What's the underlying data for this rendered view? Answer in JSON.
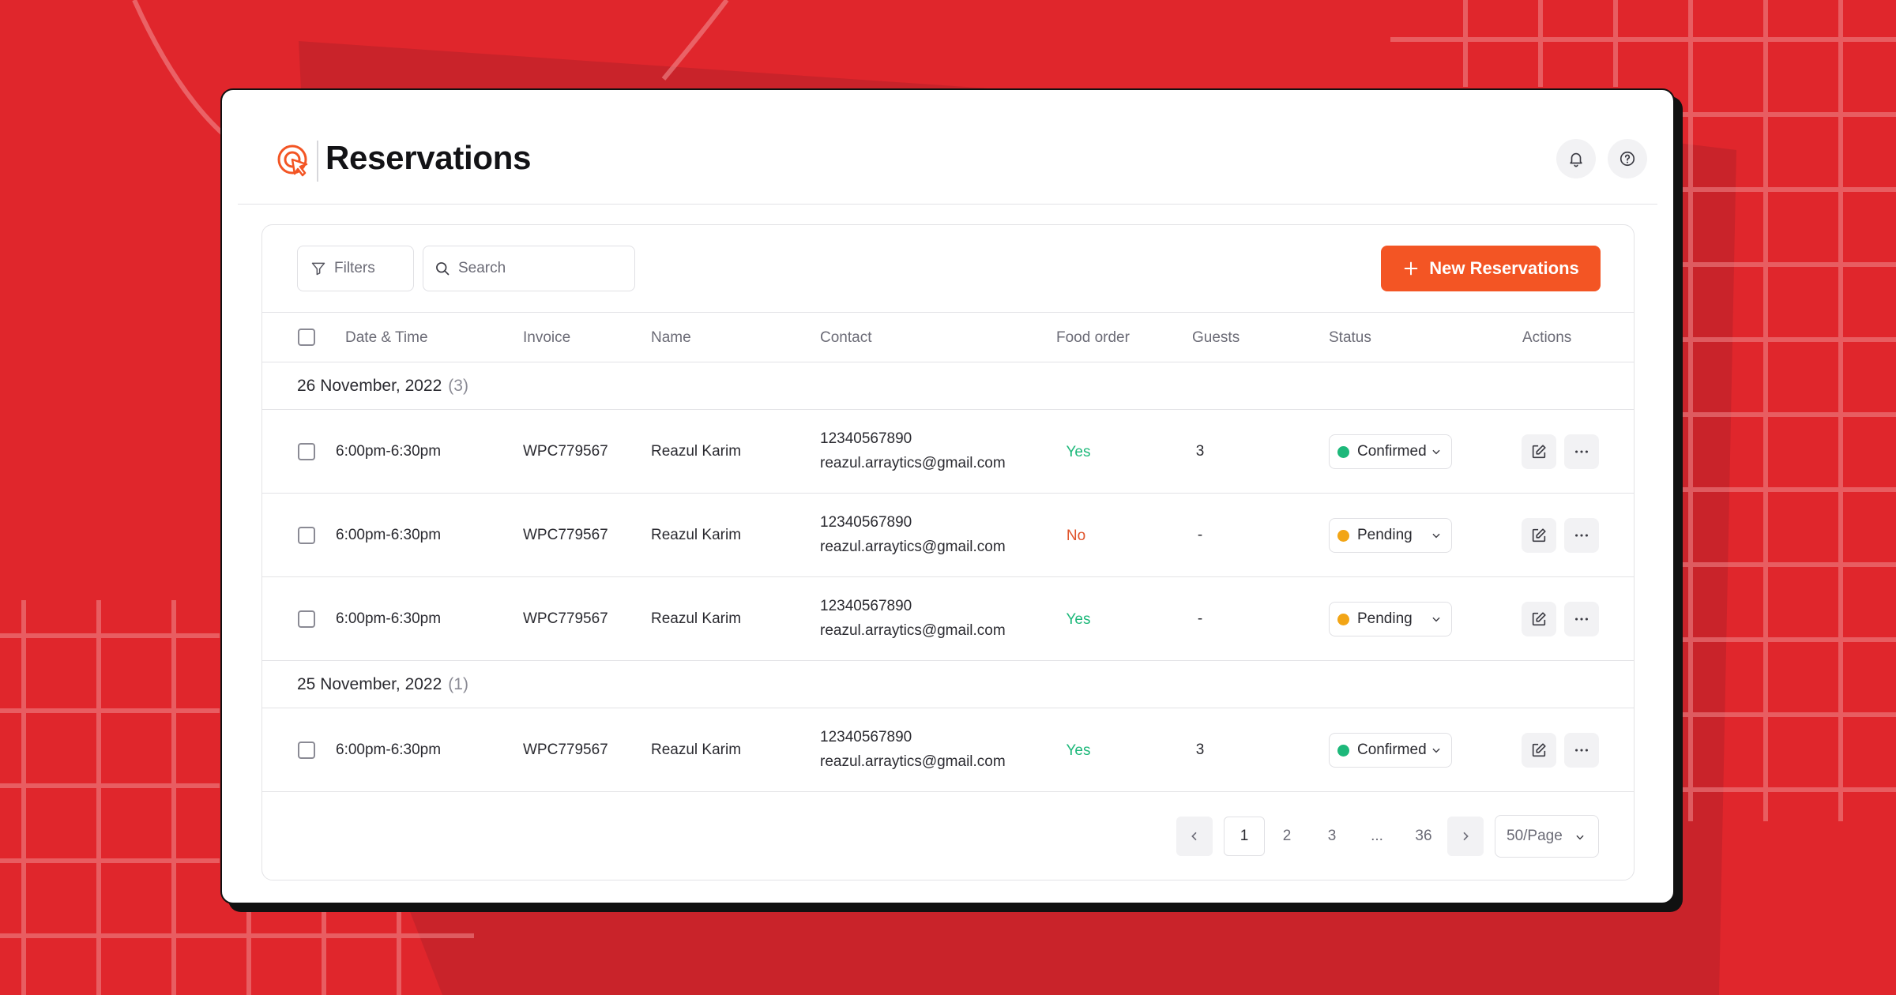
{
  "app": {
    "title": "Reservations"
  },
  "toolbar": {
    "filters_label": "Filters",
    "search_placeholder": "Search",
    "search_value": "",
    "new_button_label": "New Reservations"
  },
  "table": {
    "columns": {
      "datetime": "Date & Time",
      "invoice": "Invoice",
      "name": "Name",
      "contact": "Contact",
      "food_order": "Food order",
      "guests": "Guests",
      "status": "Status",
      "actions": "Actions"
    },
    "groups": [
      {
        "date": "26 November, 2022",
        "count": "(3)",
        "rows": [
          {
            "time": "6:00pm-6:30pm",
            "invoice": "WPC779567",
            "name": "Reazul Karim",
            "phone": "12340567890",
            "email": "reazul.arraytics@gmail.com",
            "food": "Yes",
            "guests": "3",
            "status": "Confirmed"
          },
          {
            "time": "6:00pm-6:30pm",
            "invoice": "WPC779567",
            "name": "Reazul Karim",
            "phone": "12340567890",
            "email": "reazul.arraytics@gmail.com",
            "food": "No",
            "guests": "-",
            "status": "Pending"
          },
          {
            "time": "6:00pm-6:30pm",
            "invoice": "WPC779567",
            "name": "Reazul Karim",
            "phone": "12340567890",
            "email": "reazul.arraytics@gmail.com",
            "food": "Yes",
            "guests": "-",
            "status": "Pending"
          }
        ]
      },
      {
        "date": "25 November, 2022",
        "count": "(1)",
        "rows": [
          {
            "time": "6:00pm-6:30pm",
            "invoice": "WPC779567",
            "name": "Reazul Karim",
            "phone": "12340567890",
            "email": "reazul.arraytics@gmail.com",
            "food": "Yes",
            "guests": "3",
            "status": "Confirmed"
          }
        ]
      }
    ]
  },
  "pagination": {
    "pages": [
      "1",
      "2",
      "3",
      "...",
      "36"
    ],
    "current": "1",
    "per_page": "50/Page"
  },
  "colors": {
    "background": "#e0262c",
    "accent": "#f35524",
    "confirmed": "#1db87a",
    "pending": "#f2a516",
    "yes": "#1db87a",
    "no": "#e0532a"
  },
  "icons": {
    "logo": "cursor-target-logo-icon",
    "notifications": "bell-icon",
    "help": "question-circle-icon",
    "filter": "funnel-icon",
    "search": "search-icon",
    "add": "plus-icon",
    "edit": "edit-icon",
    "more": "more-horizontal-icon",
    "prev": "chevron-left-icon",
    "next": "chevron-right-icon",
    "dropdown": "chevron-down-icon"
  }
}
